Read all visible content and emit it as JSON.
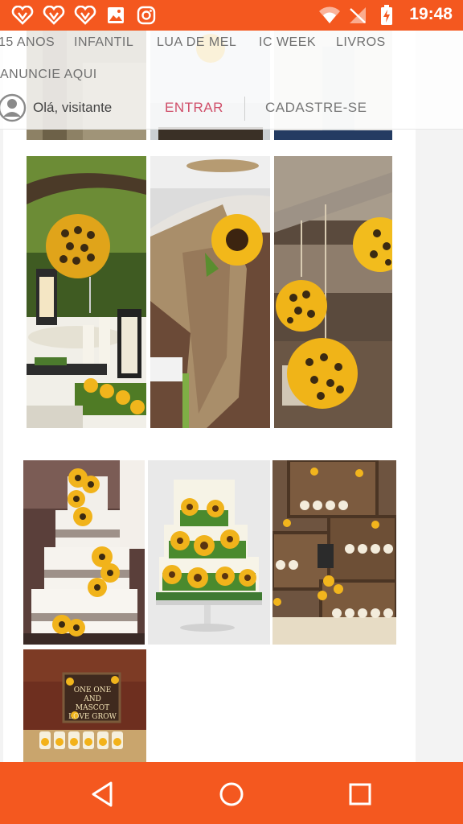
{
  "status_bar": {
    "time": "19:48",
    "left_icons": [
      "heart-badge-icon",
      "heart-badge-icon",
      "heart-badge-icon",
      "image-icon",
      "instagram-icon"
    ],
    "right_icons": [
      "wifi-icon",
      "no-signal-icon",
      "battery-charging-icon"
    ],
    "background": "#f4581f"
  },
  "nav": {
    "categories": [
      "15 ANOS",
      "INFANTIL",
      "LUA DE MEL",
      "IC WEEK",
      "LIVROS"
    ],
    "announce": "ANUNCIE AQUI",
    "greeting": "Olá, visitante",
    "login": "ENTRAR",
    "signup": "CADASTRE-SE",
    "login_color": "#d04f6a"
  },
  "photos": [
    {
      "name": "photo-table-centerpiece",
      "subject": "sunflower ball centerpiece"
    },
    {
      "name": "photo-chair-burlap",
      "subject": "sunflower on burlap chair sash"
    },
    {
      "name": "photo-hanging-balls",
      "subject": "hanging sunflower balls"
    },
    {
      "name": "photo-cake-burlap",
      "subject": "white cake with sunflowers"
    },
    {
      "name": "photo-cake-painted",
      "subject": "sunflower painted cake"
    },
    {
      "name": "photo-cupcake-crates",
      "subject": "cupcakes in wooden crates"
    },
    {
      "name": "photo-sign-treats",
      "subject": "sign with treats"
    }
  ],
  "photo_sign_text": "ONE ONE AND MASCOT LOVE GROW",
  "android_nav": {
    "buttons": [
      "back-icon",
      "home-icon",
      "recents-icon"
    ],
    "background": "#f4581f"
  }
}
